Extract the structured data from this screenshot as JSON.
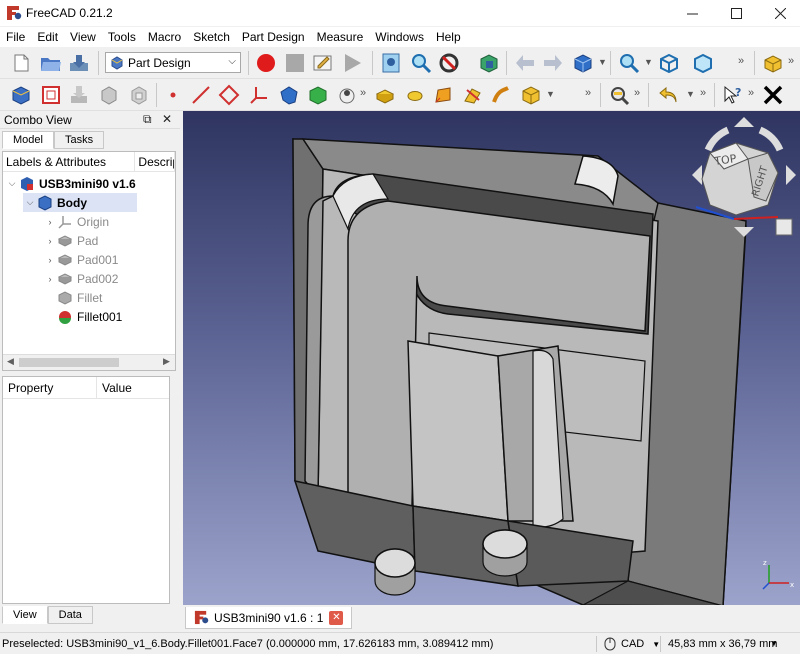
{
  "window": {
    "title": "FreeCAD 0.21.2"
  },
  "menu": [
    "File",
    "Edit",
    "View",
    "Tools",
    "Macro",
    "Sketch",
    "Part Design",
    "Measure",
    "Windows",
    "Help"
  ],
  "toolbar": {
    "workbench": "Part Design",
    "overflow": "»"
  },
  "combo_view": {
    "title": "Combo View",
    "tabs": [
      "Model",
      "Tasks"
    ],
    "tree_headers": [
      "Labels & Attributes",
      "Descrip"
    ],
    "tree": [
      {
        "label": "USB3mini90 v1.6",
        "icon": "document-icon",
        "level": 0,
        "expanded": true,
        "bold": true
      },
      {
        "label": "Body",
        "icon": "body-icon",
        "level": 1,
        "expanded": true,
        "bold": true,
        "selected": true
      },
      {
        "label": "Origin",
        "icon": "origin-icon",
        "level": 2,
        "expandable": true,
        "dim": true
      },
      {
        "label": "Pad",
        "icon": "pad-icon",
        "level": 2,
        "expandable": true,
        "dim": true
      },
      {
        "label": "Pad001",
        "icon": "pad-icon",
        "level": 2,
        "expandable": true,
        "dim": true
      },
      {
        "label": "Pad002",
        "icon": "pad-icon",
        "level": 2,
        "expandable": true,
        "dim": true
      },
      {
        "label": "Fillet",
        "icon": "fillet-icon",
        "level": 2,
        "dim": true
      },
      {
        "label": "Fillet001",
        "icon": "fillet-active-icon",
        "level": 2
      }
    ],
    "property_headers": [
      "Property",
      "Value"
    ],
    "bottom_tabs": [
      "View",
      "Data"
    ]
  },
  "navcube": {
    "faces": [
      "TOP",
      "RIGHT"
    ]
  },
  "document_tab": {
    "label": "USB3mini90 v1.6 : 1"
  },
  "status": {
    "message": "Preselected: USB3mini90_v1_6.Body.Fillet001.Face7 (0.000000 mm, 17.626183 mm, 3.089412 mm)",
    "nav_style": "CAD",
    "dimensions": "45,83 mm x 36,79 mm"
  },
  "colors": {
    "accent": "#3b6fd4",
    "viewport_top": "#2f3560",
    "viewport_bottom": "#9ca3cb"
  }
}
